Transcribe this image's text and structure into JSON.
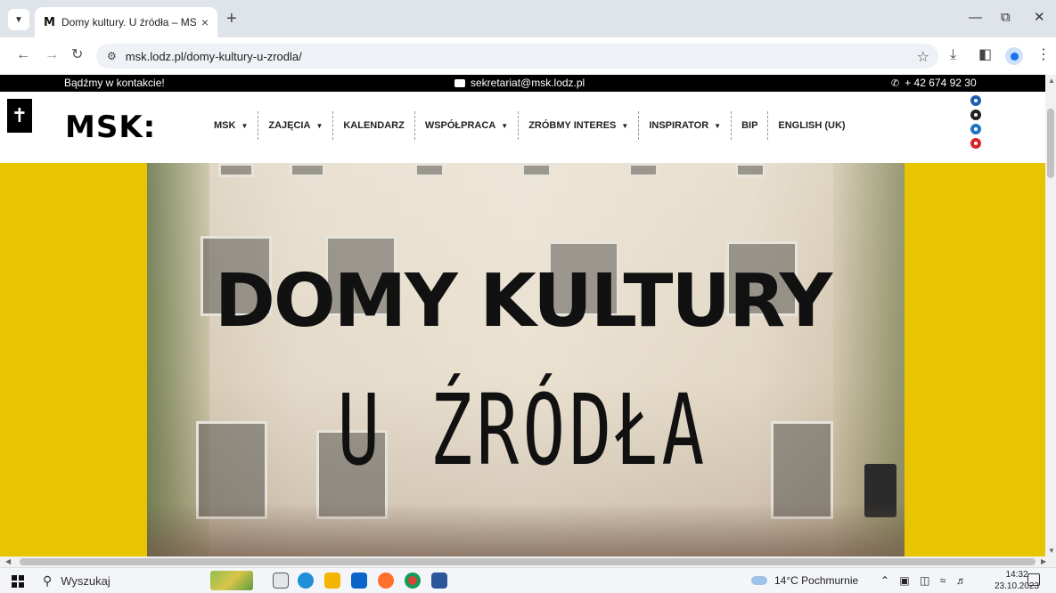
{
  "browser": {
    "tab_title": "Domy kultury. U źródła – MSK",
    "tab_favicon": "M",
    "tab_close": "×",
    "new_tab": "+",
    "url": "msk.lodz.pl/domy-kultury-u-zrodla/",
    "icons": {
      "tab_search": "chevron-down-icon",
      "back": "back-arrow-icon",
      "forward": "forward-arrow-icon",
      "reload": "reload-icon",
      "site_info": "tune-icon",
      "bookmark": "star-icon",
      "downloads": "download-icon",
      "side_panel": "side-panel-icon",
      "profile": "profile-icon",
      "menu": "kebab-menu-icon"
    }
  },
  "site": {
    "topbar": {
      "left": "Bądźmy w kontakcie!",
      "email": "sekretariat@msk.lodz.pl",
      "phone": "+ 42 674 92 30"
    },
    "logo": "MSK:",
    "accessibility_icon": "accessibility-icon",
    "menu": [
      {
        "label": "MSK",
        "dropdown": true
      },
      {
        "label": "ZAJĘCIA",
        "dropdown": true
      },
      {
        "label": "KALENDARZ",
        "dropdown": false
      },
      {
        "label": "WSPÓŁPRACA",
        "dropdown": true
      },
      {
        "label": "ZRÓBMY INTERES",
        "dropdown": true
      },
      {
        "label": "INSPIRATOR",
        "dropdown": true
      },
      {
        "label": "BIP",
        "dropdown": false
      },
      {
        "label": "ENGLISH (UK)",
        "dropdown": false
      }
    ],
    "social": [
      {
        "name": "facebook-icon",
        "color": "#1f5fb0"
      },
      {
        "name": "instagram-icon",
        "color": "#222222"
      },
      {
        "name": "linkedin-icon",
        "color": "#1e74c2"
      },
      {
        "name": "youtube-icon",
        "color": "#d9252b"
      }
    ],
    "hero": {
      "title": "DOMY KULTURY",
      "subtitle": "U ŹRÓDŁA",
      "background_color": "#e8c500"
    }
  },
  "taskbar": {
    "search_placeholder": "Wyszukaj",
    "weather": "14°C Pochmurnie",
    "time": "14:32",
    "date": "23.10.2023"
  }
}
